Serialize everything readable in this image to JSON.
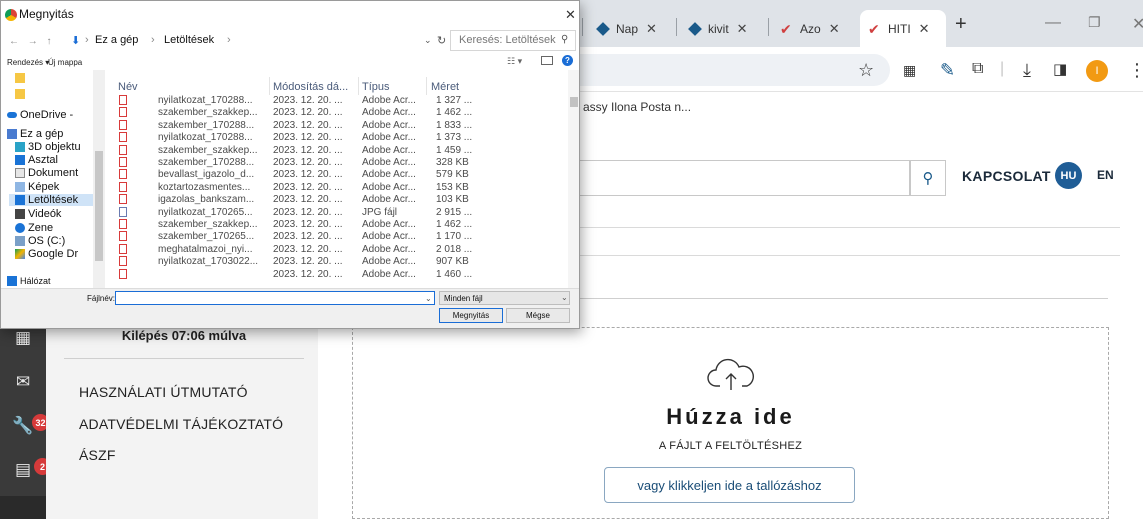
{
  "browser": {
    "tabs": [
      {
        "label": "Nap"
      },
      {
        "label": "kivit"
      },
      {
        "label": "Azo"
      },
      {
        "label": "HITI",
        "active": true
      }
    ],
    "new_tab": "+",
    "bookmark_text": "assy Ilona Posta n...",
    "profile_initial": "I",
    "accent_color": "#f29a13"
  },
  "site": {
    "contact": "KAPCSOLAT",
    "lang_hu": "HU",
    "lang_en": "EN",
    "logout_timer": "Kilépés 07:06 múlva",
    "side_links": [
      "HASZNÁLATI ÚTMUTATÓ",
      "ADATVÉDELMI TÁJÉKOZTATÓ",
      "ÁSZF"
    ],
    "badges": {
      "tools": "32",
      "news": "2"
    },
    "drop_title": "Húzza ide",
    "drop_subtitle": "A FÁJLT A FELTÖLTÉSHEZ",
    "browse_button": "vagy klikkeljen ide a tallózáshoz",
    "brand_color": "#1f5d96"
  },
  "dialog": {
    "title": "Megnyitás",
    "breadcrumb": [
      "Ez a gép",
      "Letöltések"
    ],
    "search_placeholder": "Keresés: Letöltések",
    "organize": "Rendezés ▾",
    "new_folder": "Új mappa",
    "nav_items": [
      {
        "label": "",
        "icon": "folder-icon"
      },
      {
        "label": "",
        "icon": "folder-icon"
      },
      {
        "label": "OneDrive -",
        "icon": "cloud-icon"
      },
      {
        "label": "Ez a gép",
        "icon": "computer-icon"
      },
      {
        "label": "3D objektu",
        "icon": "cube-icon"
      },
      {
        "label": "Asztal",
        "icon": "desktop-icon"
      },
      {
        "label": "Dokument",
        "icon": "document-icon"
      },
      {
        "label": "Képek",
        "icon": "pictures-icon"
      },
      {
        "label": "Letöltések",
        "icon": "download-icon",
        "selected": true
      },
      {
        "label": "Videók",
        "icon": "video-icon"
      },
      {
        "label": "Zene",
        "icon": "music-icon"
      },
      {
        "label": "OS (C:)",
        "icon": "drive-icon"
      },
      {
        "label": "Google Dr",
        "icon": "google-drive-icon"
      },
      {
        "label": "Hálózat",
        "icon": "network-icon"
      }
    ],
    "columns": {
      "name": "Név",
      "date": "Módosítás dá...",
      "type": "Típus",
      "size": "Méret"
    },
    "files": [
      {
        "name": "nyilatkozat_170288...",
        "date": "2023. 12. 20. ...",
        "type": "Adobe Acr...",
        "size": "1 327 ...",
        "icon": "pdf-icon"
      },
      {
        "name": "szakember_szakkep...",
        "date": "2023. 12. 20. ...",
        "type": "Adobe Acr...",
        "size": "1 462 ...",
        "icon": "pdf-icon"
      },
      {
        "name": "szakember_170288...",
        "date": "2023. 12. 20. ...",
        "type": "Adobe Acr...",
        "size": "1 833 ...",
        "icon": "pdf-icon"
      },
      {
        "name": "nyilatkozat_170288...",
        "date": "2023. 12. 20. ...",
        "type": "Adobe Acr...",
        "size": "1 373 ...",
        "icon": "pdf-icon"
      },
      {
        "name": "szakember_szakkep...",
        "date": "2023. 12. 20. ...",
        "type": "Adobe Acr...",
        "size": "1 459 ...",
        "icon": "pdf-icon"
      },
      {
        "name": "szakember_170288...",
        "date": "2023. 12. 20. ...",
        "type": "Adobe Acr...",
        "size": "328 KB",
        "icon": "pdf-icon"
      },
      {
        "name": "bevallast_igazolo_d...",
        "date": "2023. 12. 20. ...",
        "type": "Adobe Acr...",
        "size": "579 KB",
        "icon": "pdf-icon"
      },
      {
        "name": "koztartozasmentes...",
        "date": "2023. 12. 20. ...",
        "type": "Adobe Acr...",
        "size": "153 KB",
        "icon": "pdf-icon"
      },
      {
        "name": "igazolas_bankszam...",
        "date": "2023. 12. 20. ...",
        "type": "Adobe Acr...",
        "size": "103 KB",
        "icon": "pdf-icon"
      },
      {
        "name": "nyilatkozat_170265...",
        "date": "2023. 12. 20. ...",
        "type": "JPG fájl",
        "size": "2 915 ...",
        "icon": "image-icon"
      },
      {
        "name": "szakember_szakkep...",
        "date": "2023. 12. 20. ...",
        "type": "Adobe Acr...",
        "size": "1 462 ...",
        "icon": "pdf-icon"
      },
      {
        "name": "szakember_170265...",
        "date": "2023. 12. 20. ...",
        "type": "Adobe Acr...",
        "size": "1 170 ...",
        "icon": "pdf-icon"
      },
      {
        "name": "meghatalmazoi_nyi...",
        "date": "2023. 12. 20. ...",
        "type": "Adobe Acr...",
        "size": "2 018 ...",
        "icon": "pdf-icon"
      },
      {
        "name": "nyilatkozat_1703022...",
        "date": "2023. 12. 20. ...",
        "type": "Adobe Acr...",
        "size": "907 KB",
        "icon": "pdf-icon"
      },
      {
        "name": "",
        "date": "2023. 12. 20. ...",
        "type": "Adobe Acr...",
        "size": "1 460 ...",
        "icon": "pdf-icon"
      }
    ],
    "filename_label": "Fájlnév:",
    "filename_value": "",
    "filter": "Minden fájl",
    "open_button": "Megnyitás",
    "cancel_button": "Mégse"
  }
}
